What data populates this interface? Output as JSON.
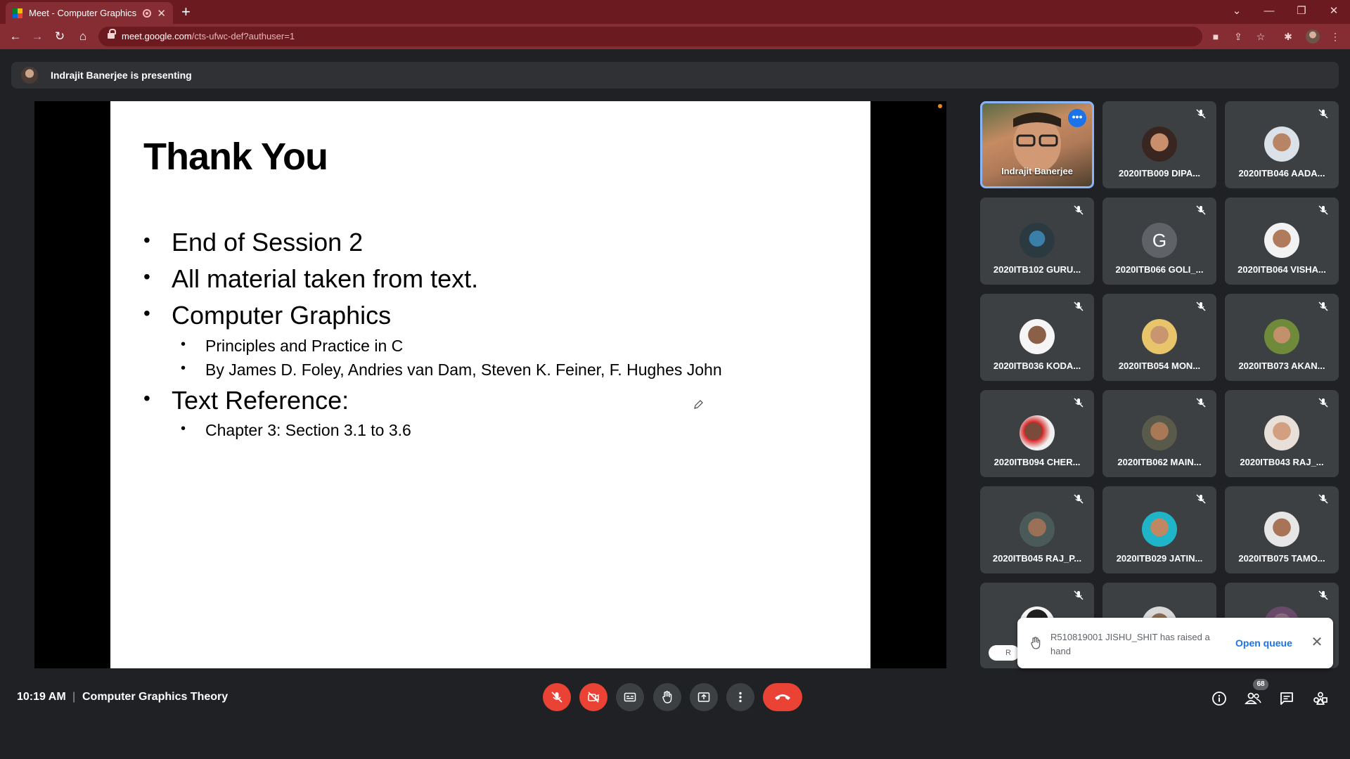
{
  "browser": {
    "tab_title": "Meet - Computer Graphics T",
    "new_tab": "+",
    "url_host": "meet.google.com",
    "url_path": "/cts-ufwc-def?authuser=1"
  },
  "banner": {
    "text": "Indrajit Banerjee is presenting"
  },
  "slide": {
    "title": "Thank You",
    "bullets": [
      "End of Session 2",
      "All material taken from text.",
      "Computer Graphics",
      "Principles and Practice in C",
      "By James D. Foley, Andries van Dam, Steven K. Feiner, F. Hughes John",
      "Text Reference:",
      "Chapter 3: Section 3.1 to 3.6"
    ]
  },
  "participants": [
    "Indrajit Banerjee",
    "2020ITB009 DIPA...",
    "2020ITB046 AADA...",
    "2020ITB102 GURU...",
    "2020ITB066 GOLI_...",
    "2020ITB064 VISHA...",
    "2020ITB036 KODA...",
    "2020ITB054 MON...",
    "2020ITB073 AKAN...",
    "2020ITB094 CHER...",
    "2020ITB062 MAIN...",
    "2020ITB043 RAJ_...",
    "2020ITB045 RAJ_P...",
    "2020ITB029 JATIN...",
    "2020ITB075 TAMO..."
  ],
  "avatar_letter": "G",
  "toast": {
    "message": "R510819001 JISHU_SHIT has raised a hand",
    "action": "Open queue",
    "chip_text": "R"
  },
  "bottom": {
    "time": "10:19 AM",
    "separator": "|",
    "meeting_name": "Computer Graphics Theory",
    "people_count": "68"
  },
  "colors": {
    "chrome_dark": "#6b1a1f",
    "chrome_tab": "#862c33",
    "meet_bg": "#202124",
    "tile_bg": "#3c4043",
    "red": "#ea4335",
    "blue": "#1a73e8"
  }
}
